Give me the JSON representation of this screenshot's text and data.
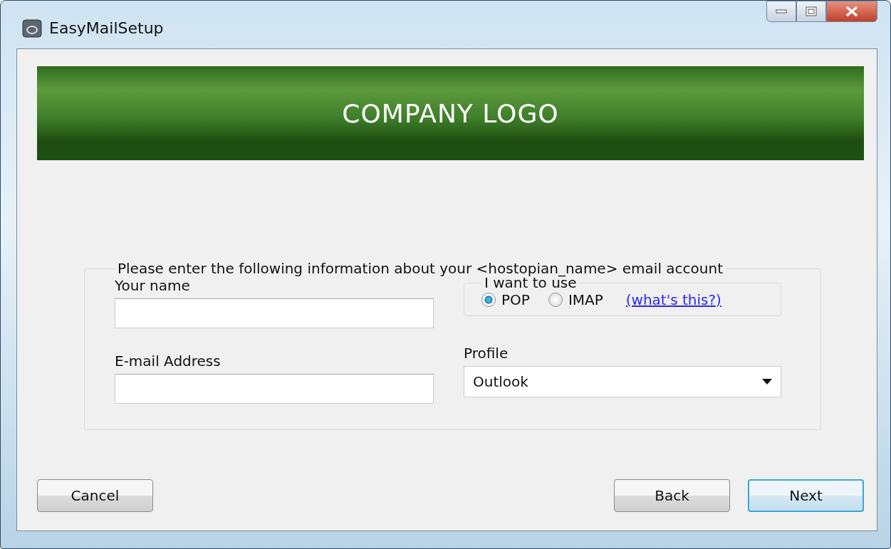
{
  "window": {
    "title": "EasyMailSetup"
  },
  "banner": {
    "text": "COMPANY LOGO"
  },
  "account_group": {
    "legend": "Please enter the following information about your <hostopian_name> email account"
  },
  "fields": [
    {
      "label": "Your name"
    },
    {
      "label": "E-mail Address"
    }
  ],
  "protocol": {
    "legend": "I want to use",
    "options": [
      {
        "label": "POP",
        "selected": true
      },
      {
        "label": "IMAP",
        "selected": false
      }
    ],
    "help_link": "(what's this?)"
  },
  "profile": {
    "label": "Profile",
    "value": "Outlook"
  },
  "buttons": [
    {
      "label": "Cancel",
      "default": false
    },
    {
      "label": "Back",
      "default": false
    },
    {
      "label": "Next",
      "default": true
    }
  ]
}
